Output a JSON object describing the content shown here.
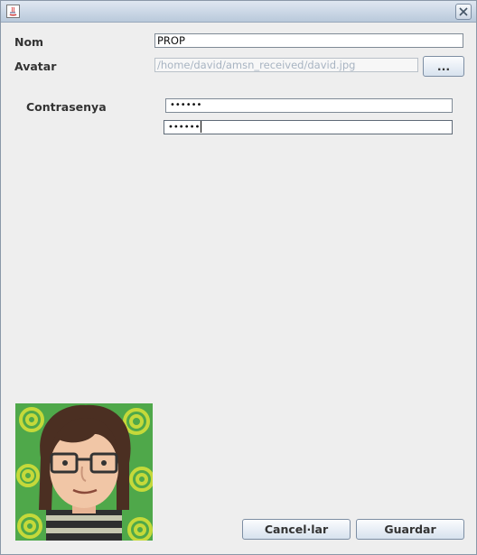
{
  "window": {
    "icon": "java-app-icon",
    "close_icon": "close-icon"
  },
  "form": {
    "name_label": "Nom",
    "name_value": "PROP",
    "avatar_label": "Avatar",
    "avatar_path": "/home/david/amsn_received/david.jpg",
    "browse_label": "...",
    "password_label": "Contrasenya",
    "password_mask": "••••••",
    "password_confirm_mask": "••••••"
  },
  "preview": {
    "image": "cartoon-avatar-with-glasses"
  },
  "actions": {
    "cancel_label": "Cancel·lar",
    "save_label": "Guardar"
  },
  "colors": {
    "title_gradient_top": "#dfe7f1",
    "title_gradient_bottom": "#b9c9db",
    "window_bg": "#eeeeee",
    "avatar_bg": "#4fa84a"
  }
}
